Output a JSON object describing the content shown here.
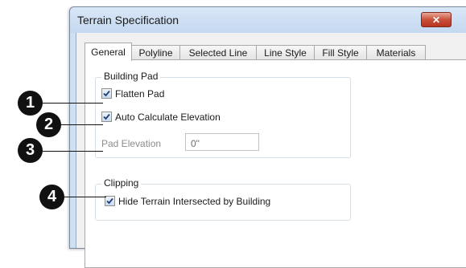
{
  "dialog": {
    "title": "Terrain Specification",
    "close_glyph": "✕",
    "tabs": [
      {
        "label": "General",
        "active": true
      },
      {
        "label": "Polyline",
        "active": false
      },
      {
        "label": "Selected Line",
        "active": false
      },
      {
        "label": "Line Style",
        "active": false
      },
      {
        "label": "Fill Style",
        "active": false
      },
      {
        "label": "Materials",
        "active": false
      }
    ]
  },
  "building_pad": {
    "group_label": "Building Pad",
    "flatten_pad": {
      "label": "Flatten Pad",
      "checked": true
    },
    "auto_calculate": {
      "label": "Auto Calculate Elevation",
      "checked": true
    },
    "pad_elevation": {
      "label": "Pad Elevation",
      "value": "0\"",
      "disabled": true
    }
  },
  "clipping": {
    "group_label": "Clipping",
    "hide_terrain": {
      "label": "Hide Terrain Intersected by Building",
      "checked": true
    }
  },
  "callouts": [
    "1",
    "2",
    "3",
    "4"
  ]
}
